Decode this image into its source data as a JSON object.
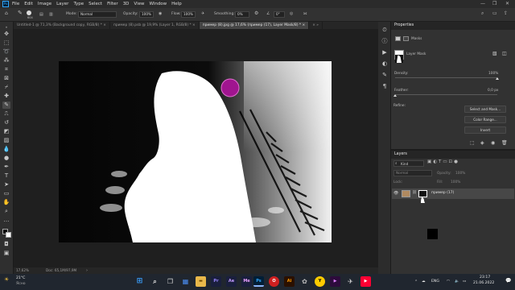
{
  "menubar": {
    "logo": "Ps",
    "items": [
      "File",
      "Edit",
      "Image",
      "Layer",
      "Type",
      "Select",
      "Filter",
      "3D",
      "View",
      "Window",
      "Help"
    ]
  },
  "options": {
    "brush_size": "604",
    "mode_label": "Mode:",
    "mode_value": "Normal",
    "opacity_label": "Opacity:",
    "opacity_value": "100%",
    "flow_label": "Flow:",
    "flow_value": "100%",
    "smoothing_label": "Smoothing:",
    "smoothing_value": "0%",
    "angle_value": "0°"
  },
  "tabs": [
    {
      "label": "Untitled-1 @ 71,3% (Background copy, RGB/8) * ×"
    },
    {
      "label": "пример (8).psb @ 19,9% (Layer 1, RGB/8) * ×"
    },
    {
      "label": "пример (8).jpg @ 17,6% (пример (17), Layer Mask/8) * ×"
    },
    {
      "label": "× »"
    }
  ],
  "status": {
    "zoom": "17,62%",
    "doc": "Doc: 65,1M/97,9M"
  },
  "properties": {
    "title": "Properties",
    "masks_label": "Masks",
    "layer_mask_label": "Layer Mask",
    "density_label": "Density:",
    "density_value": "100%",
    "density_level": 1.0,
    "feather_label": "Feather:",
    "feather_value": "0,0 px",
    "feather_level": 0.0,
    "refine_label": "Refine:",
    "select_mask_btn": "Select and Mask...",
    "color_range_btn": "Color Range...",
    "invert_btn": "Invert"
  },
  "layers": {
    "title": "Layers",
    "kind_label": "Kind",
    "blend_mode": "Normal",
    "opacity_label": "Opacity:",
    "opacity_value": "100%",
    "lock_label": "Lock:",
    "fill_label": "Fill:",
    "fill_value": "100%",
    "rows": [
      {
        "name": "пример (17)"
      }
    ]
  },
  "taskbar": {
    "weather_temp": "21°C",
    "weather_desc": "Ясно",
    "lang": "ENG",
    "time": "23:17",
    "date": "21.06.2022"
  },
  "colors": {
    "accent_ps": "#31a8ff",
    "brush_cursor": "#a0158f"
  }
}
